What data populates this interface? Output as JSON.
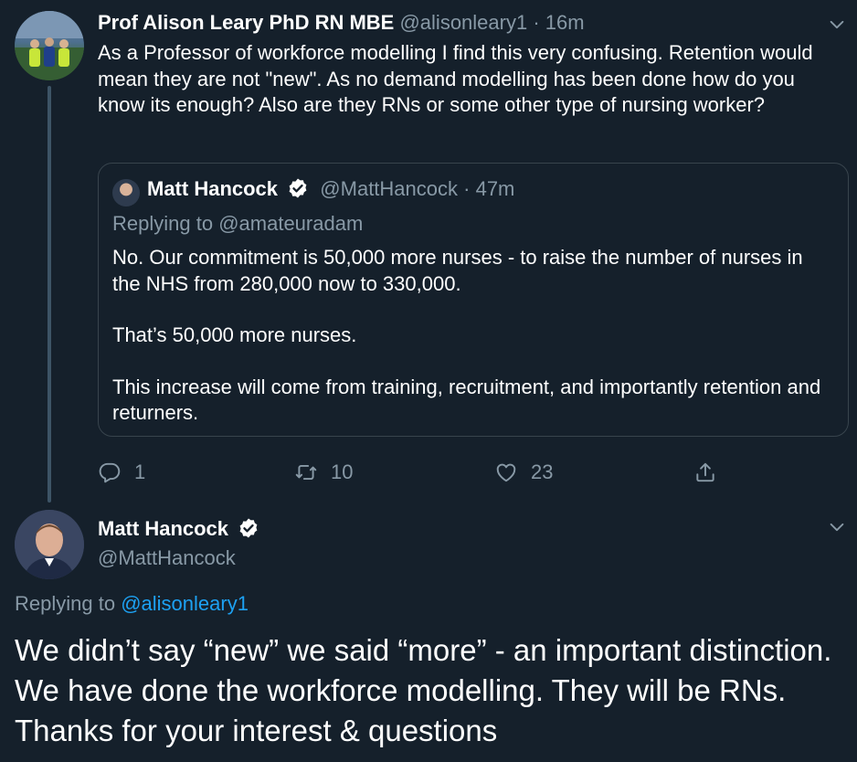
{
  "tweet1": {
    "name": "Prof Alison Leary PhD RN MBE",
    "handle": "@alisonleary1",
    "time": "· 16m",
    "body": "As a Professor of workforce modelling I find this very confusing. Retention would mean they are not \"new\". As no demand modelling has been done how do you know its enough? Also are they RNs or some other type of nursing worker?",
    "quoted": {
      "name": "Matt Hancock",
      "handle": "@MattHancock",
      "time": "· 47m",
      "replying_label": "Replying to",
      "replying_to": "@amateuradam",
      "paragraphs": [
        "No. Our commitment is 50,000 more nurses - to raise the number of nurses in the NHS from 280,000 now to 330,000.",
        "That’s 50,000 more nurses.",
        "This increase will come from training, recruitment, and importantly retention and returners."
      ]
    },
    "actions": {
      "reply_count": "1",
      "retweet_count": "10",
      "like_count": "23"
    }
  },
  "tweet2": {
    "name": "Matt Hancock",
    "handle": "@MattHancock",
    "replying_label": "Replying to",
    "replying_to": "@alisonleary1",
    "body": "We didn’t say “new” we said “more” - an important distinction. We have done the workforce modelling. They will be RNs. Thanks for your interest & questions"
  },
  "colors": {
    "background": "#15202b",
    "muted": "#8899a6",
    "link": "#1da1f2",
    "border": "#38444d"
  },
  "icons": [
    "chevron-down-icon",
    "verified-icon",
    "reply-icon",
    "retweet-icon",
    "like-icon",
    "share-icon"
  ]
}
